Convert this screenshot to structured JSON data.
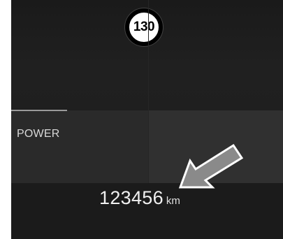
{
  "speed_limit": {
    "value": "130",
    "icon": "speed-limit-sign-icon"
  },
  "power": {
    "label": "POWER"
  },
  "odometer": {
    "value": "123456",
    "unit": "km"
  },
  "annotation": {
    "icon": "pointer-arrow-icon"
  },
  "colors": {
    "screen_background": "#1c1c1c",
    "band_background": "#2b2b2b",
    "text_primary": "#f0f0f0",
    "sign_border": "#000000",
    "sign_fill": "#ffffff"
  }
}
